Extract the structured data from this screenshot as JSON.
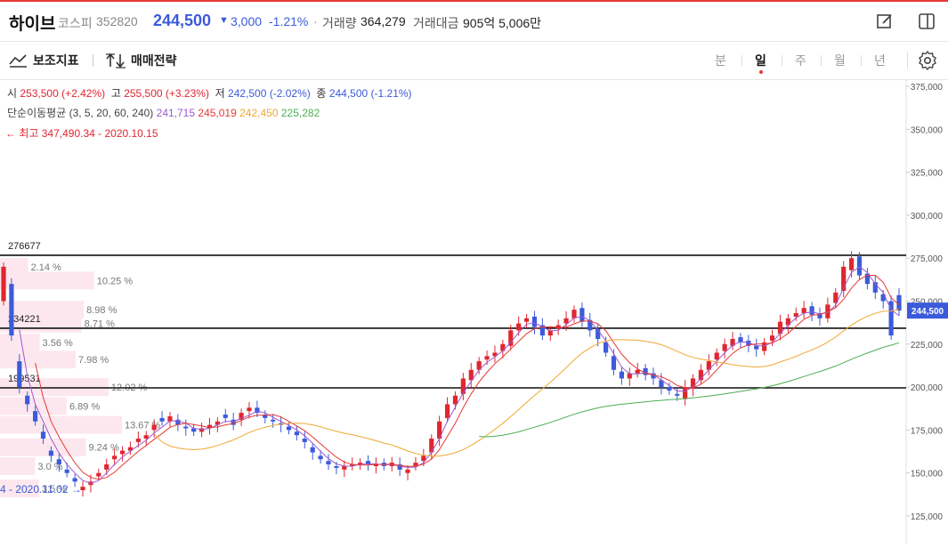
{
  "header": {
    "name": "하이브",
    "market": "코스피",
    "code": "352820",
    "price": "244,500",
    "change_arrow": "▼",
    "change": "3,000",
    "change_pct": "-1.21%",
    "sep": "·",
    "volume_label": "거래량",
    "volume": "364,279",
    "value_label": "거래대금",
    "value": "905억 5,006만"
  },
  "toolbar": {
    "indicator_label": "보조지표",
    "strategy_label": "매매전략",
    "periods": [
      "분",
      "일",
      "주",
      "월",
      "년"
    ],
    "active_period": "일"
  },
  "ohlc": {
    "open_label": "시",
    "open": "253,500 (+2.42%)",
    "high_label": "고",
    "high": "255,500 (+3.23%)",
    "low_label": "저",
    "low": "242,500 (-2.02%)",
    "close_label": "종",
    "close": "244,500 (-1.21%)"
  },
  "ma": {
    "label": "단순이동평균 (3, 5, 20, 60, 240)",
    "v3": "241,715",
    "v5": "245,019",
    "v20": "242,450",
    "v60": "225,282"
  },
  "annotations": {
    "high": "← 최고 347,490.34 - 2020.10.15",
    "low": "4 - 2020.11.02 →",
    "level1": "276677",
    "level2": "234221",
    "level3": "199531",
    "current_price": "244,500"
  },
  "colors": {
    "up": "#e0262f",
    "down": "#3b5bdb",
    "ma3": "#9b59d0",
    "ma5": "#e53935",
    "ma20": "#f0a830",
    "ma60": "#4caf50",
    "profile": "#fde7ee"
  },
  "chart_data": {
    "type": "candlestick",
    "y_ticks": [
      375000,
      350000,
      325000,
      300000,
      275000,
      250000,
      225000,
      200000,
      175000,
      150000,
      125000
    ],
    "y_tick_labels": [
      "375,000",
      "350,000",
      "325,000",
      "300,000",
      "275,000",
      "250,000",
      "225,000",
      "200,000",
      "175,000",
      "150,000",
      "125,000"
    ],
    "ylim": [
      117000,
      380000
    ],
    "horizontal_lines": [
      276677,
      234221,
      199531
    ],
    "volume_profile": [
      {
        "pct": "2.14 %",
        "value": 2.14,
        "price": 270000
      },
      {
        "pct": "10.25 %",
        "value": 10.25,
        "price": 262000
      },
      {
        "pct": "8.98 %",
        "value": 8.98,
        "price": 245000
      },
      {
        "pct": "8.71 %",
        "value": 8.71,
        "price": 237000
      },
      {
        "pct": "3.56 %",
        "value": 3.56,
        "price": 226000
      },
      {
        "pct": "7.98 %",
        "value": 7.98,
        "price": 216000
      },
      {
        "pct": "12.02 %",
        "value": 12.02,
        "price": 200000
      },
      {
        "pct": "6.89 %",
        "value": 6.89,
        "price": 189000
      },
      {
        "pct": "13.67 %",
        "value": 13.67,
        "price": 178000
      },
      {
        "pct": "9.24 %",
        "value": 9.24,
        "price": 165000
      },
      {
        "pct": "3.0 %",
        "value": 3.0,
        "price": 154000
      },
      {
        "pct": "3.5 %",
        "value": 3.5,
        "price": 141000
      }
    ],
    "closes": [
      270000,
      230000,
      200000,
      190000,
      180000,
      170000,
      160000,
      155000,
      150000,
      145000,
      142000,
      145000,
      150000,
      155000,
      160000,
      163000,
      165000,
      170000,
      172000,
      178000,
      180000,
      183000,
      178000,
      176000,
      174000,
      176000,
      178000,
      180000,
      182000,
      178000,
      185000,
      188000,
      185000,
      182000,
      180000,
      178000,
      175000,
      172000,
      168000,
      162000,
      158000,
      155000,
      153000,
      154000,
      155000,
      156000,
      155000,
      155000,
      154000,
      156000,
      152000,
      152000,
      156000,
      160000,
      170000,
      180000,
      190000,
      195000,
      205000,
      210000,
      215000,
      218000,
      220000,
      225000,
      233000,
      237000,
      240000,
      235000,
      230000,
      233000,
      236000,
      240000,
      245000,
      238000,
      233000,
      228000,
      220000,
      210000,
      205000,
      208000,
      210000,
      207000,
      205000,
      200000,
      198000,
      195000,
      200000,
      205000,
      210000,
      215000,
      220000,
      225000,
      228000,
      226000,
      224000,
      222000,
      226000,
      230000,
      238000,
      240000,
      243000,
      246000,
      242000,
      240000,
      248000,
      255000,
      270000,
      275000,
      265000,
      260000,
      255000,
      250000,
      230000,
      244500
    ],
    "opens": [
      250000,
      260000,
      215000,
      195000,
      186000,
      174000,
      163000,
      158000,
      152000,
      147000,
      140000,
      143000,
      148000,
      152000,
      158000,
      161000,
      163000,
      168000,
      170000,
      175000,
      182000,
      180000,
      181000,
      177000,
      176000,
      174000,
      176000,
      178000,
      184000,
      181000,
      181000,
      186000,
      188000,
      184000,
      181000,
      179000,
      177000,
      174000,
      170000,
      165000,
      160000,
      157000,
      154000,
      152000,
      154000,
      155000,
      157000,
      154000,
      156000,
      154000,
      155000,
      150000,
      154000,
      157000,
      162000,
      170000,
      182000,
      190000,
      196000,
      204000,
      210000,
      216000,
      218000,
      221000,
      224000,
      233000,
      238000,
      241000,
      236000,
      230000,
      234000,
      237000,
      240000,
      246000,
      239000,
      234000,
      226000,
      218000,
      209000,
      205000,
      208000,
      211000,
      208000,
      204000,
      200000,
      196000,
      193000,
      199000,
      204000,
      210000,
      216000,
      221000,
      224000,
      229000,
      227000,
      224000,
      221000,
      227000,
      231000,
      236000,
      241000,
      243000,
      247000,
      243000,
      240000,
      249000,
      256000,
      268000,
      276000,
      266000,
      261000,
      254000,
      250000,
      253500
    ]
  }
}
